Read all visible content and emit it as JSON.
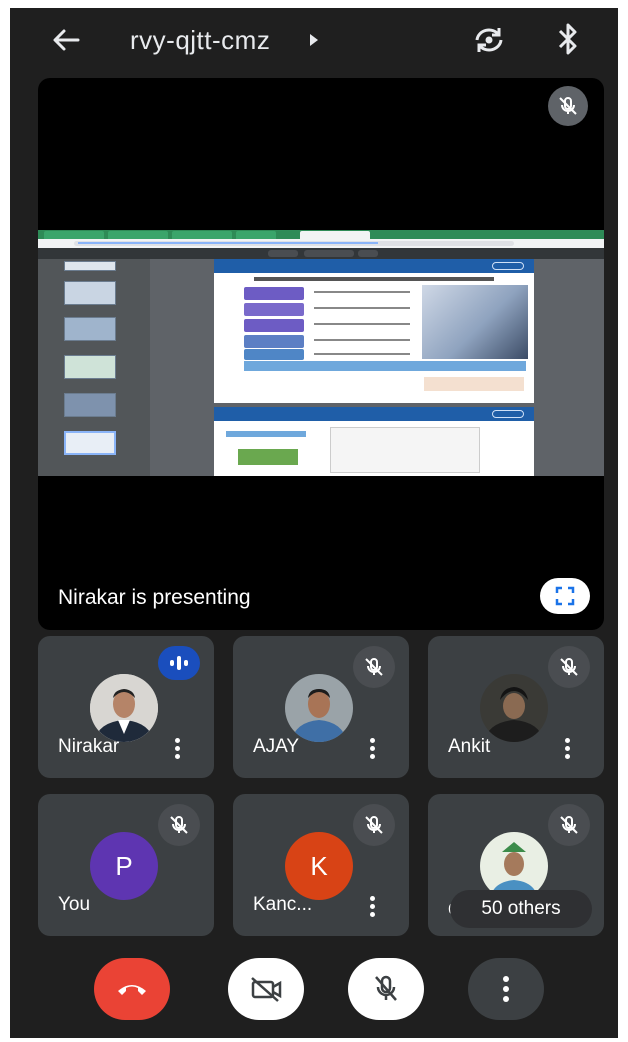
{
  "topbar": {
    "meeting_code": "rvy-qjtt-cmz",
    "icons": [
      "back-arrow-icon",
      "caret-right-icon",
      "switch-camera-icon",
      "bluetooth-icon"
    ]
  },
  "presentation": {
    "status": "Nirakar is presenting",
    "icons": [
      "mic-off-icon",
      "fullscreen-icon"
    ]
  },
  "participants": [
    {
      "name": "Nirakar",
      "state": "speaking"
    },
    {
      "name": "AJAY",
      "state": "muted"
    },
    {
      "name": "Ankit",
      "state": "muted"
    },
    {
      "name": "You",
      "initial": "P",
      "avatar_color": "#5e35b1",
      "state": "muted"
    },
    {
      "name": "Kanc...",
      "initial": "K",
      "avatar_color": "#d84315",
      "state": "muted"
    },
    {
      "name": "de",
      "state": "muted",
      "others_label": "50 others"
    }
  ],
  "controls": {
    "end_call_color": "#ea4335",
    "icons": [
      "end-call-icon",
      "camera-off-icon",
      "mic-off-icon",
      "more-options-icon"
    ]
  },
  "colors": {
    "background": "#1f1f1f",
    "tile": "#3c4043",
    "speaking_badge": "#1a4ebd"
  }
}
